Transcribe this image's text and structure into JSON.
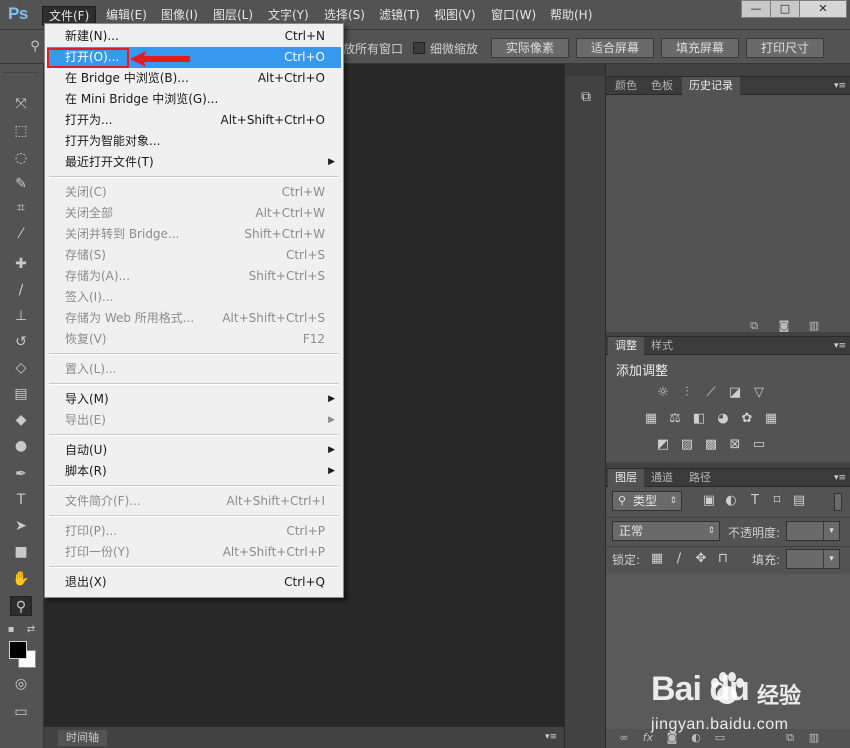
{
  "app": {
    "logo": "Ps"
  },
  "menubar": {
    "items": [
      "文件(F)",
      "编辑(E)",
      "图像(I)",
      "图层(L)",
      "文字(Y)",
      "选择(S)",
      "滤镜(T)",
      "视图(V)",
      "窗口(W)",
      "帮助(H)"
    ],
    "active_index": 0
  },
  "window_controls": {
    "minimize": "—",
    "maximize": "□",
    "close": "✕"
  },
  "options_bar": {
    "all_windows_label": "放所有窗口",
    "scrubby_zoom_label": "细微缩放",
    "buttons": [
      "实际像素",
      "适合屏幕",
      "填充屏幕",
      "打印尺寸"
    ]
  },
  "file_menu": {
    "groups": [
      [
        {
          "label": "新建(N)...",
          "shortcut": "Ctrl+N",
          "enabled": true
        },
        {
          "label": "打开(O)...",
          "shortcut": "Ctrl+O",
          "enabled": true,
          "highlighted": true
        },
        {
          "label": "在 Bridge 中浏览(B)...",
          "shortcut": "Alt+Ctrl+O",
          "enabled": true
        },
        {
          "label": "在 Mini Bridge 中浏览(G)...",
          "shortcut": "",
          "enabled": true
        },
        {
          "label": "打开为...",
          "shortcut": "Alt+Shift+Ctrl+O",
          "enabled": true
        },
        {
          "label": "打开为智能对象...",
          "shortcut": "",
          "enabled": true
        },
        {
          "label": "最近打开文件(T)",
          "shortcut": "",
          "enabled": true,
          "submenu": true
        }
      ],
      [
        {
          "label": "关闭(C)",
          "shortcut": "Ctrl+W",
          "enabled": false
        },
        {
          "label": "关闭全部",
          "shortcut": "Alt+Ctrl+W",
          "enabled": false
        },
        {
          "label": "关闭并转到 Bridge...",
          "shortcut": "Shift+Ctrl+W",
          "enabled": false
        },
        {
          "label": "存储(S)",
          "shortcut": "Ctrl+S",
          "enabled": false
        },
        {
          "label": "存储为(A)...",
          "shortcut": "Shift+Ctrl+S",
          "enabled": false
        },
        {
          "label": "签入(I)...",
          "shortcut": "",
          "enabled": false
        },
        {
          "label": "存储为 Web 所用格式...",
          "shortcut": "Alt+Shift+Ctrl+S",
          "enabled": false
        },
        {
          "label": "恢复(V)",
          "shortcut": "F12",
          "enabled": false
        }
      ],
      [
        {
          "label": "置入(L)...",
          "shortcut": "",
          "enabled": false
        }
      ],
      [
        {
          "label": "导入(M)",
          "shortcut": "",
          "enabled": true,
          "submenu": true
        },
        {
          "label": "导出(E)",
          "shortcut": "",
          "enabled": false,
          "submenu": true
        }
      ],
      [
        {
          "label": "自动(U)",
          "shortcut": "",
          "enabled": true,
          "submenu": true
        },
        {
          "label": "脚本(R)",
          "shortcut": "",
          "enabled": true,
          "submenu": true
        }
      ],
      [
        {
          "label": "文件简介(F)...",
          "shortcut": "Alt+Shift+Ctrl+I",
          "enabled": false
        }
      ],
      [
        {
          "label": "打印(P)...",
          "shortcut": "Ctrl+P",
          "enabled": false
        },
        {
          "label": "打印一份(Y)",
          "shortcut": "Alt+Shift+Ctrl+P",
          "enabled": false
        }
      ],
      [
        {
          "label": "退出(X)",
          "shortcut": "Ctrl+Q",
          "enabled": true
        }
      ]
    ]
  },
  "panels": {
    "history": {
      "tabs": [
        "颜色",
        "色板",
        "历史记录"
      ],
      "active_index": 2
    },
    "adjustments": {
      "tabs": [
        "调整",
        "样式"
      ],
      "active_index": 0,
      "heading": "添加调整"
    },
    "layers": {
      "tabs": [
        "图层",
        "通道",
        "路径"
      ],
      "active_index": 0,
      "filter_kind": "类型",
      "blend_mode": "正常",
      "opacity_label": "不透明度:",
      "lock_label": "锁定:",
      "fill_label": "填充:"
    }
  },
  "bottom": {
    "timeline_tab": "时间轴"
  },
  "watermark": {
    "brand": "Bai du",
    "cn": "经验",
    "url": "jingyan.baidu.com"
  },
  "colors": {
    "ui_bg": "#535353",
    "canvas": "#282828",
    "menu_bg": "#f0f0f0",
    "highlight": "#3798f0",
    "annotation_red": "#e51b24",
    "logo_blue": "#7bc3f0"
  }
}
